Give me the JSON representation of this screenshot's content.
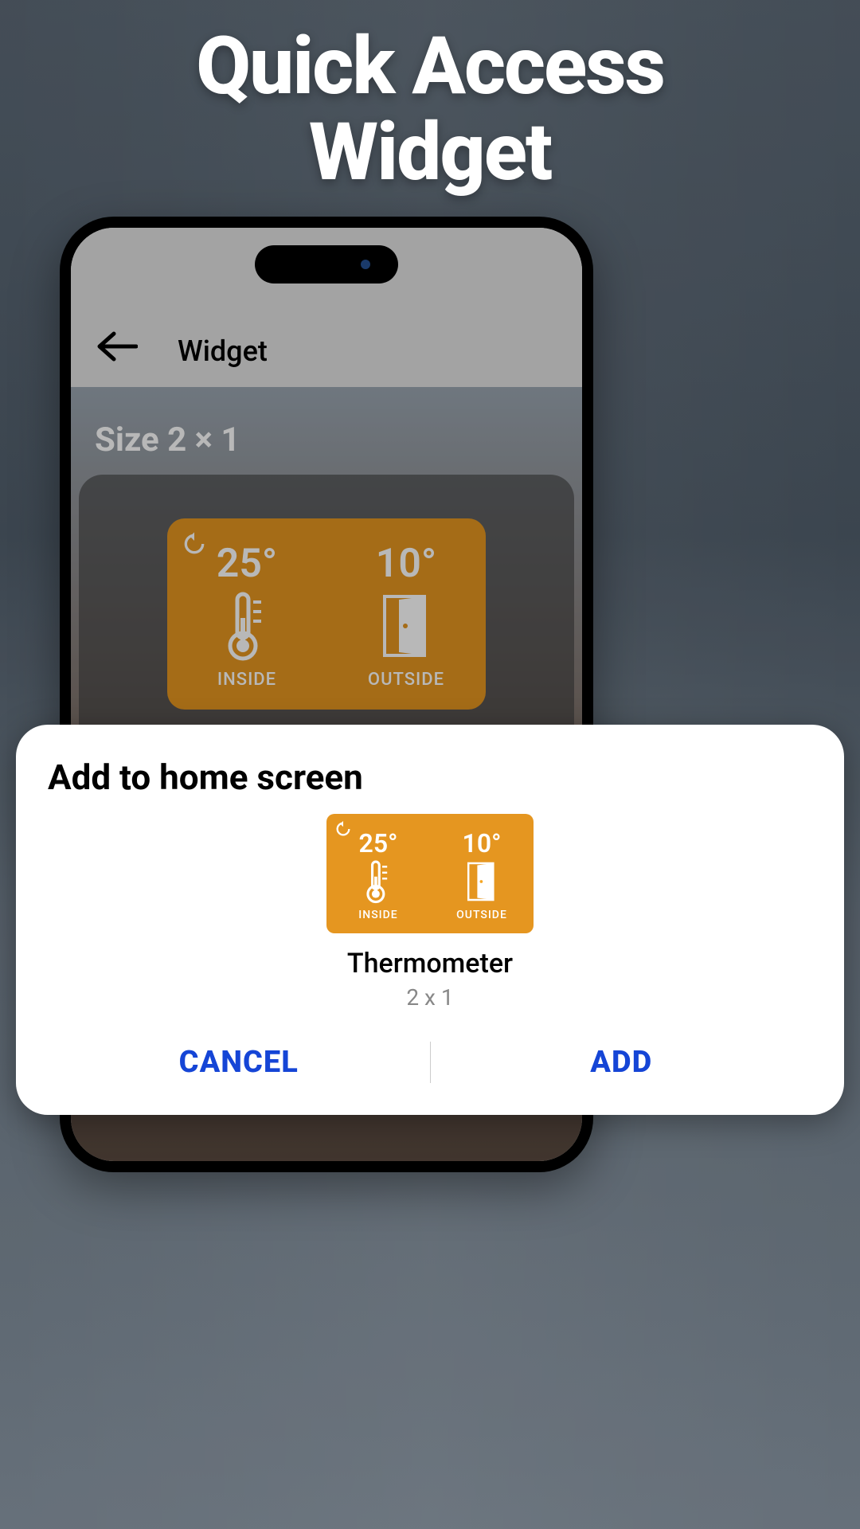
{
  "hero": {
    "line1": "Quick Access",
    "line2": "Widget"
  },
  "nav": {
    "title": "Widget"
  },
  "preview": {
    "size_label": "Size 2 × 1"
  },
  "widget": {
    "inside": {
      "temp": "25°",
      "label": "INSIDE"
    },
    "outside": {
      "temp": "10°",
      "label": "OUTSIDE"
    }
  },
  "sheet": {
    "title": "Add to home screen",
    "name": "Thermometer",
    "size": "2 x 1",
    "cancel": "CANCEL",
    "add": "ADD"
  }
}
